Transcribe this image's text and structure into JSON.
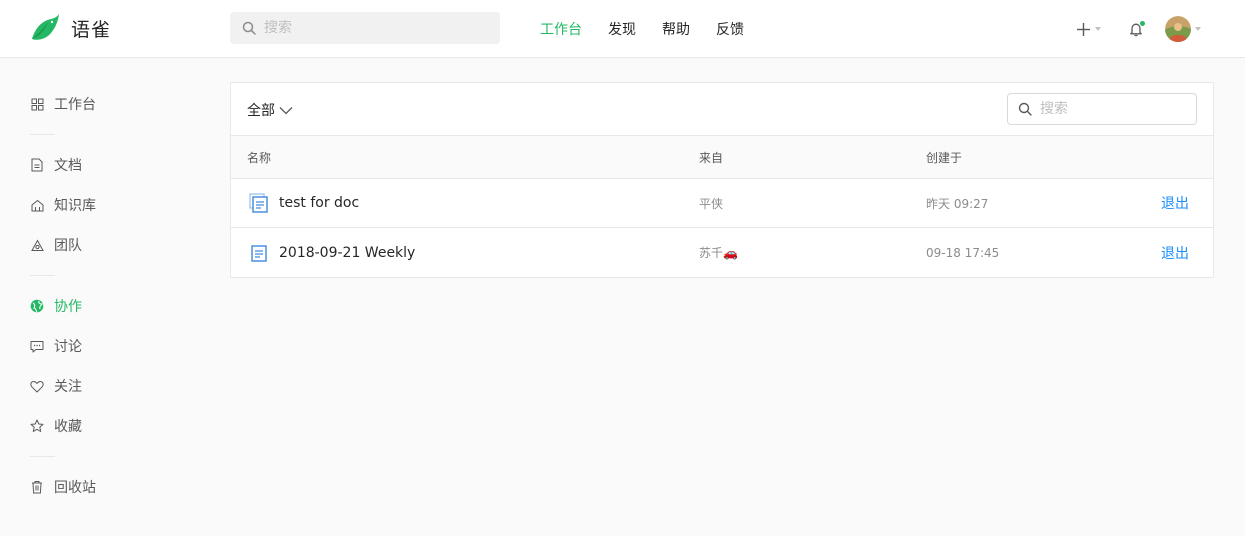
{
  "app": {
    "name": "语雀"
  },
  "header": {
    "search_placeholder": "搜索",
    "nav": [
      {
        "label": "工作台",
        "active": true
      },
      {
        "label": "发现",
        "active": false
      },
      {
        "label": "帮助",
        "active": false
      },
      {
        "label": "反馈",
        "active": false
      }
    ]
  },
  "sidebar": {
    "items": [
      {
        "label": "工作台",
        "icon": "grid-icon"
      },
      {
        "label": "文档",
        "icon": "document-icon"
      },
      {
        "label": "知识库",
        "icon": "library-icon"
      },
      {
        "label": "团队",
        "icon": "team-icon"
      },
      {
        "label": "协作",
        "icon": "globe-icon",
        "active": true
      },
      {
        "label": "讨论",
        "icon": "comment-icon"
      },
      {
        "label": "关注",
        "icon": "heart-icon"
      },
      {
        "label": "收藏",
        "icon": "star-icon"
      },
      {
        "label": "回收站",
        "icon": "trash-icon"
      }
    ]
  },
  "main": {
    "filter_label": "全部",
    "search_placeholder": "搜索",
    "columns": {
      "name": "名称",
      "from": "来自",
      "created": "创建于"
    },
    "rows": [
      {
        "title": "test for doc",
        "from": "平侠",
        "from_emoji": "",
        "created": "昨天 09:27",
        "action": "退出",
        "icon": "doc-stack-icon"
      },
      {
        "title": "2018-09-21 Weekly",
        "from": "苏千",
        "from_emoji": "🚗",
        "created": "09-18 17:45",
        "action": "退出",
        "icon": "document-icon"
      }
    ]
  },
  "colors": {
    "accent": "#25b864",
    "link": "#1890ff",
    "doc_icon": "#4a90e2"
  }
}
